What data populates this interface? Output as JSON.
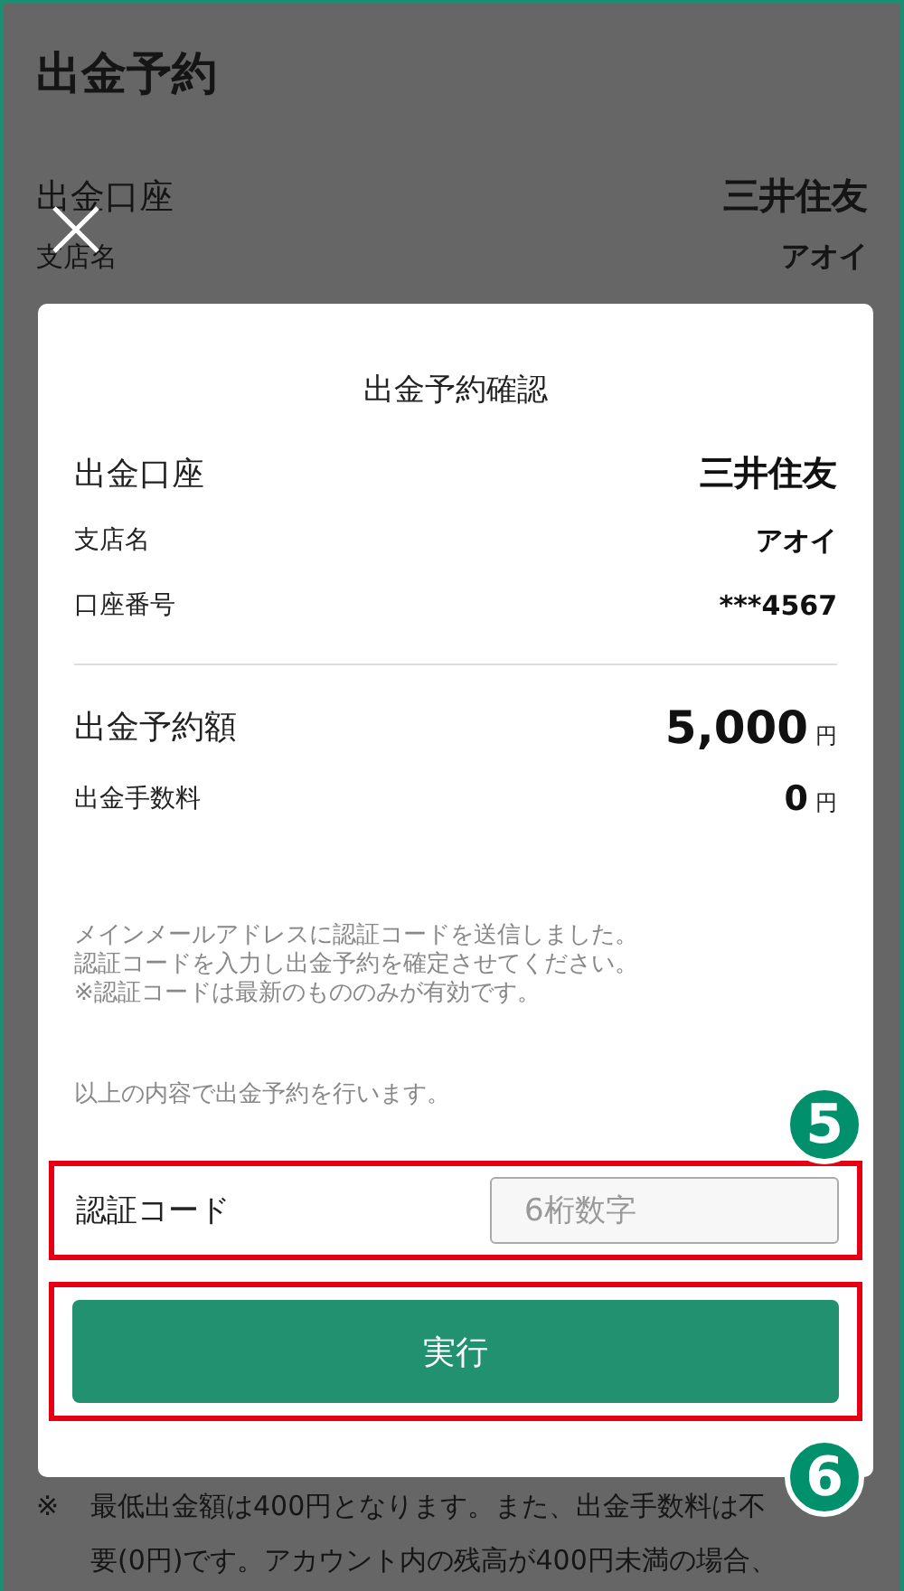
{
  "page": {
    "title": "出金予約",
    "rows": [
      {
        "label": "出金口座",
        "value": "三井住友"
      },
      {
        "label": "支店名",
        "value": "アオイ"
      }
    ],
    "note": {
      "mark": "※",
      "lines": [
        "最低出金額は400円となります。また、出金手数料は不",
        "要(0円)です。アカウント内の残高が400円未満の場合、"
      ]
    }
  },
  "dialog": {
    "title": "出金予約確認",
    "account_rows": [
      {
        "label": "出金口座",
        "value": "三井住友",
        "kind": "primary"
      },
      {
        "label": "支店名",
        "value": "アオイ",
        "kind": "secondary"
      },
      {
        "label": "口座番号",
        "value": "***4567",
        "kind": "secondary"
      }
    ],
    "amount_rows": [
      {
        "label": "出金予約額",
        "value": "5,000",
        "unit": "円",
        "kind": "primary"
      },
      {
        "label": "出金手数料",
        "value": "0",
        "unit": "円",
        "kind": "secondary"
      }
    ],
    "message": [
      "メインメールアドレスに認証コードを送信しました。",
      "認証コードを入力し出金予約を確定させてください。",
      "※認証コードは最新のもののみが有効です。"
    ],
    "confirm_text": "以上の内容で出金予約を行います。",
    "code_field": {
      "label": "認証コード",
      "placeholder": "6桁数字"
    },
    "submit_button": "実行"
  },
  "callouts": [
    {
      "number": "5"
    },
    {
      "number": "6"
    }
  ]
}
